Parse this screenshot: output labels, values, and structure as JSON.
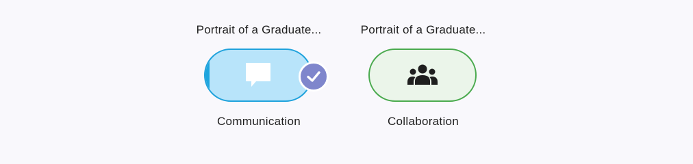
{
  "cards": [
    {
      "title": "Portrait of a Graduate...",
      "label": "Communication",
      "icon": "speech-bubble-icon",
      "selected": true,
      "colors": {
        "fill": "#b8e4fa",
        "border": "#1fa2dc",
        "badge": "#7f86cc"
      }
    },
    {
      "title": "Portrait of a Graduate...",
      "label": "Collaboration",
      "icon": "group-people-icon",
      "selected": false,
      "colors": {
        "fill": "#ebf5ea",
        "border": "#4aaa4e"
      }
    }
  ]
}
